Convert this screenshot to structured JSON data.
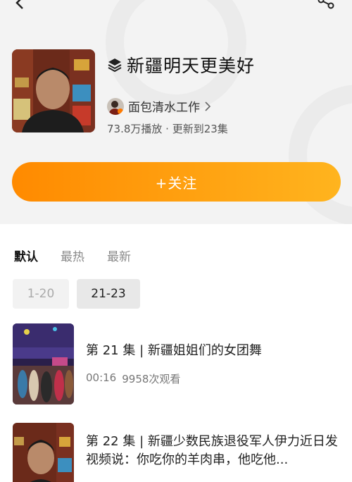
{
  "header": {
    "title": "新疆明天更美好",
    "author": "面包清水工作",
    "stats": "73.8万播放 · 更新到23集",
    "follow_label": "+关注"
  },
  "icons": {
    "back": "chevron-left-icon",
    "share": "share-icon",
    "collection": "layers-icon",
    "author_link": "chevron-right-icon"
  },
  "colors": {
    "accent_start": "#ff8a00",
    "accent_end": "#ffb41e"
  },
  "sort_tabs": [
    "默认",
    "最热",
    "最新"
  ],
  "range_tabs": [
    "1-20",
    "21-23"
  ],
  "episodes": [
    {
      "title": "第 21 集 | 新疆姐姐们的女团舞",
      "duration": "00:16",
      "views": "9958次观看"
    },
    {
      "title": "第 22 集 | 新疆少数民族退役军人伊力近日发视频说：你吃你的羊肉串，他吃他..."
    }
  ]
}
